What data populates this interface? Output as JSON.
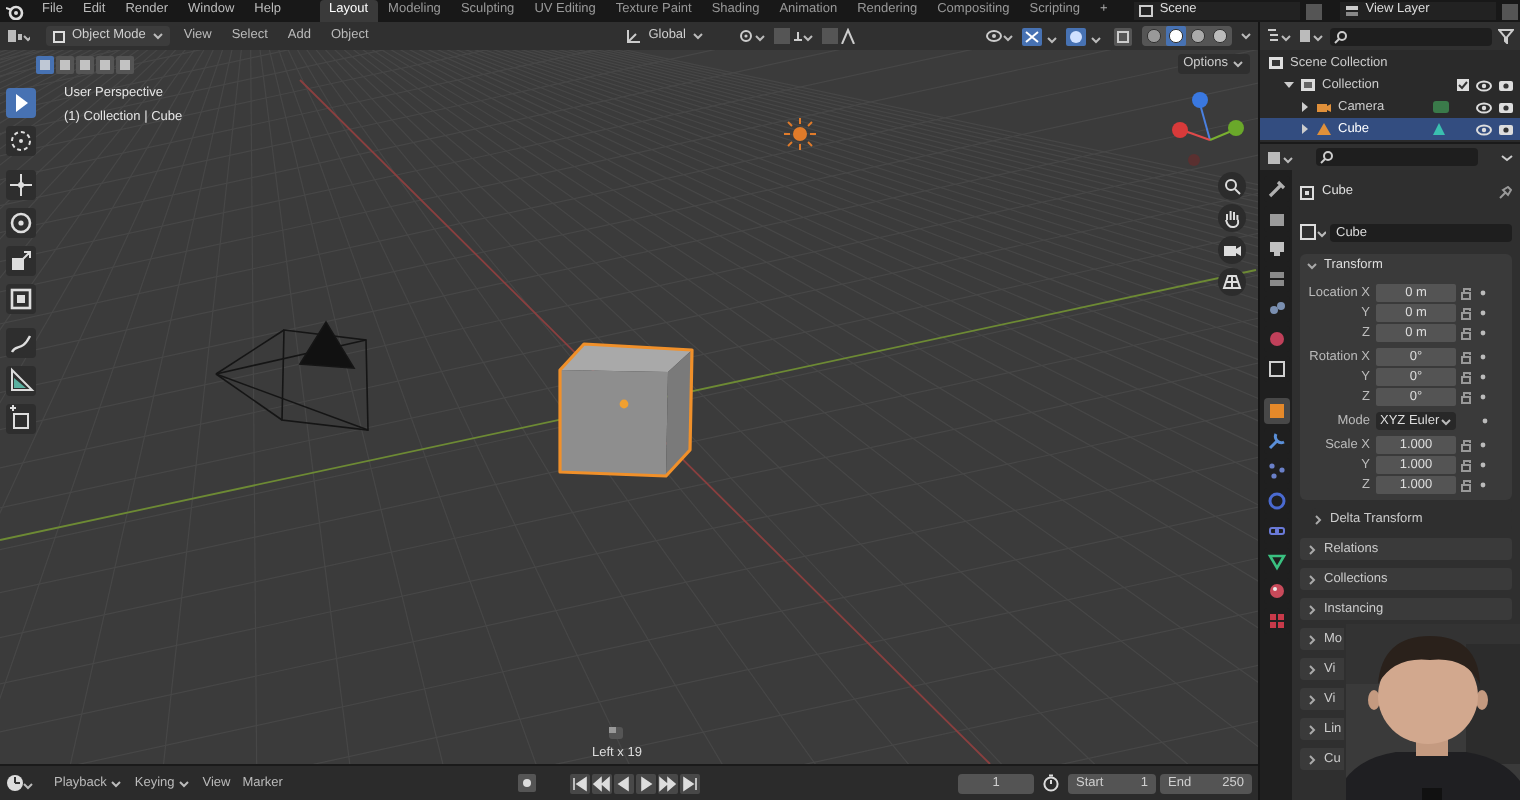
{
  "topbar": {
    "menus": [
      "File",
      "Edit",
      "Render",
      "Window",
      "Help"
    ],
    "workspaces": [
      {
        "label": "Layout",
        "selected": true
      },
      {
        "label": "Modeling",
        "selected": false
      },
      {
        "label": "Sculpting",
        "selected": false
      },
      {
        "label": "UV Editing",
        "selected": false
      },
      {
        "label": "Texture Paint",
        "selected": false
      },
      {
        "label": "Shading",
        "selected": false
      },
      {
        "label": "Animation",
        "selected": false
      },
      {
        "label": "Rendering",
        "selected": false
      },
      {
        "label": "Compositing",
        "selected": false
      },
      {
        "label": "Scripting",
        "selected": false
      }
    ],
    "add_workspace": "+",
    "scene": "Scene",
    "view_layer": "View Layer"
  },
  "viewport": {
    "mode": "Object Mode",
    "menus": [
      "View",
      "Select",
      "Add",
      "Object"
    ],
    "orientation": "Global",
    "shading_modes": [
      {
        "selected": false
      },
      {
        "selected": true
      },
      {
        "selected": false
      },
      {
        "selected": false
      }
    ],
    "select_modes": [
      {
        "selected": true
      },
      {
        "selected": false
      },
      {
        "selected": false
      },
      {
        "selected": false
      },
      {
        "selected": false
      }
    ],
    "options": "Options",
    "overlay_text": [
      "User Perspective",
      "(1) Collection | Cube"
    ],
    "tools": [
      {
        "kind": "select",
        "selected": true
      },
      {
        "kind": "cursor",
        "selected": false
      },
      {
        "kind": "move",
        "selected": false
      },
      {
        "kind": "rotate",
        "selected": false
      },
      {
        "kind": "scale",
        "selected": false
      },
      {
        "kind": "transform",
        "selected": false
      },
      {
        "kind": "annotate",
        "selected": false
      },
      {
        "kind": "measure",
        "selected": false
      },
      {
        "kind": "add_cube",
        "selected": false
      }
    ],
    "last_operation": "Left x 19"
  },
  "timeline": {
    "menus": [
      {
        "label": "Playback",
        "dropdown": true
      },
      {
        "label": "Keying",
        "dropdown": true
      },
      {
        "label": "View",
        "dropdown": false
      },
      {
        "label": "Marker",
        "dropdown": false
      }
    ],
    "current_frame": "1",
    "start_label": "Start",
    "start": "1",
    "end_label": "End",
    "end": "250"
  },
  "outliner": {
    "items": [
      {
        "label": "Scene Collection",
        "kind": "scene",
        "selected": false,
        "children": [
          {
            "label": "Collection",
            "kind": "collection",
            "selected": false,
            "expanded": true,
            "children": [
              {
                "label": "Camera",
                "kind": "camera",
                "selected": false,
                "expanded": false
              },
              {
                "label": "Cube",
                "kind": "mesh",
                "selected": true,
                "expanded": false
              }
            ]
          }
        ]
      }
    ]
  },
  "properties": {
    "tabs": [
      {
        "kind": "tool",
        "color": "#b0b0b0",
        "selected": false
      },
      {
        "kind": "render",
        "color": "#9a9a9a",
        "selected": false
      },
      {
        "kind": "output",
        "color": "#c0c0c0",
        "selected": false
      },
      {
        "kind": "view_layer",
        "color": "#8a8a8a",
        "selected": false
      },
      {
        "kind": "scene",
        "color": "#7a8fb0",
        "selected": false
      },
      {
        "kind": "world",
        "color": "#c0405a",
        "selected": false
      },
      {
        "kind": "collection",
        "color": "#d0d0d0",
        "selected": false
      },
      {
        "kind": "object",
        "color": "#e5892a",
        "selected": true
      },
      {
        "kind": "modifiers",
        "color": "#5a8fd8",
        "selected": false
      },
      {
        "kind": "particles",
        "color": "#6a80c8",
        "selected": false
      },
      {
        "kind": "physics",
        "color": "#4a6ad0",
        "selected": false
      },
      {
        "kind": "constraints",
        "color": "#6a7ad8",
        "selected": false
      },
      {
        "kind": "data",
        "color": "#3ac080",
        "selected": false
      },
      {
        "kind": "material",
        "color": "#c84a5a",
        "selected": false
      },
      {
        "kind": "texture",
        "color": "#c83a4a",
        "selected": false
      }
    ],
    "object_name": "Cube",
    "datablock": "Cube",
    "transform": {
      "title": "Transform",
      "expanded": true,
      "groups": [
        [
          {
            "label": "Location X",
            "value": "0 m",
            "kind": "field"
          },
          {
            "label": "Y",
            "value": "0 m",
            "kind": "field"
          },
          {
            "label": "Z",
            "value": "0 m",
            "kind": "field"
          }
        ],
        [
          {
            "label": "Rotation X",
            "value": "0°",
            "kind": "field"
          },
          {
            "label": "Y",
            "value": "0°",
            "kind": "field"
          },
          {
            "label": "Z",
            "value": "0°",
            "kind": "field"
          }
        ],
        [
          {
            "label": "Mode",
            "value": "XYZ Euler",
            "kind": "dropdown"
          }
        ],
        [
          {
            "label": "Scale X",
            "value": "1.000",
            "kind": "field"
          },
          {
            "label": "Y",
            "value": "1.000",
            "kind": "field"
          },
          {
            "label": "Z",
            "value": "1.000",
            "kind": "field"
          }
        ]
      ]
    },
    "panels": [
      {
        "label": "Delta Transform",
        "kind": "subpanel",
        "expanded": false
      },
      {
        "label": "Relations",
        "kind": "panel",
        "expanded": false
      },
      {
        "label": "Collections",
        "kind": "panel",
        "expanded": false
      },
      {
        "label": "Instancing",
        "kind": "panel",
        "expanded": false
      },
      {
        "label": "Mo",
        "kind": "panel",
        "expanded": false
      },
      {
        "label": "Vi",
        "kind": "panel",
        "expanded": false
      },
      {
        "label": "Vi",
        "kind": "panel",
        "expanded": false
      },
      {
        "label": "Lin",
        "kind": "panel",
        "expanded": false
      },
      {
        "label": "Cu",
        "kind": "panel",
        "expanded": false
      }
    ]
  }
}
